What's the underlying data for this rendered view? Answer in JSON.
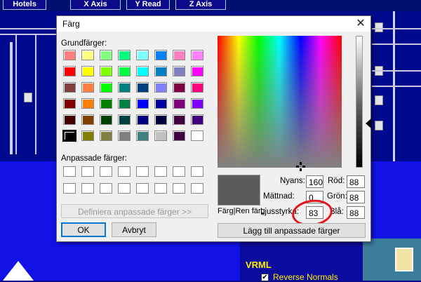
{
  "background": {
    "tabs": [
      "Hotels",
      "X Axis",
      "Y Read",
      "Z Axis"
    ],
    "vrml_title": "VRML",
    "vrml_item": "Reverse Normals",
    "vrml_check_mark": "✔"
  },
  "dialog": {
    "title": "Färg",
    "close_glyph": "✕",
    "basic_colors_label": "Grundfärger:",
    "basic_colors": [
      "#ff8080",
      "#ffff80",
      "#80ff80",
      "#00ff80",
      "#80ffff",
      "#0080ff",
      "#ff80c0",
      "#ff80ff",
      "#ff0000",
      "#ffff00",
      "#80ff00",
      "#00ff40",
      "#00ffff",
      "#0080c0",
      "#8080c0",
      "#ff00ff",
      "#804040",
      "#ff8040",
      "#00ff00",
      "#008080",
      "#004080",
      "#8080ff",
      "#800040",
      "#ff0080",
      "#800000",
      "#ff8000",
      "#008000",
      "#008040",
      "#0000ff",
      "#0000a0",
      "#800080",
      "#8000ff",
      "#400000",
      "#804000",
      "#004000",
      "#004040",
      "#000080",
      "#000040",
      "#400040",
      "#400080",
      "#000000",
      "#808000",
      "#808040",
      "#808080",
      "#408080",
      "#c0c0c0",
      "#400040",
      "#ffffff"
    ],
    "selected_basic_index": 40,
    "custom_colors_label": "Anpassade färger:",
    "define_custom_button": "Definiera anpassade färger >>",
    "ok_button": "OK",
    "cancel_button": "Avbryt",
    "preview_label": "Färg|Ren färg",
    "preview_color": "#5b5b5b",
    "hue_label": "Nyans:",
    "hue_value": "160",
    "sat_label": "Mättnad:",
    "sat_value": "0",
    "lum_label": "Ljusstyrka:",
    "lum_value": "83",
    "red_label": "Röd:",
    "red_value": "88",
    "green_label": "Grön:",
    "green_value": "88",
    "blue_label": "Blå:",
    "blue_value": "88",
    "add_custom_button": "Lägg till anpassade färger",
    "annotation_color": "#e4141c"
  }
}
